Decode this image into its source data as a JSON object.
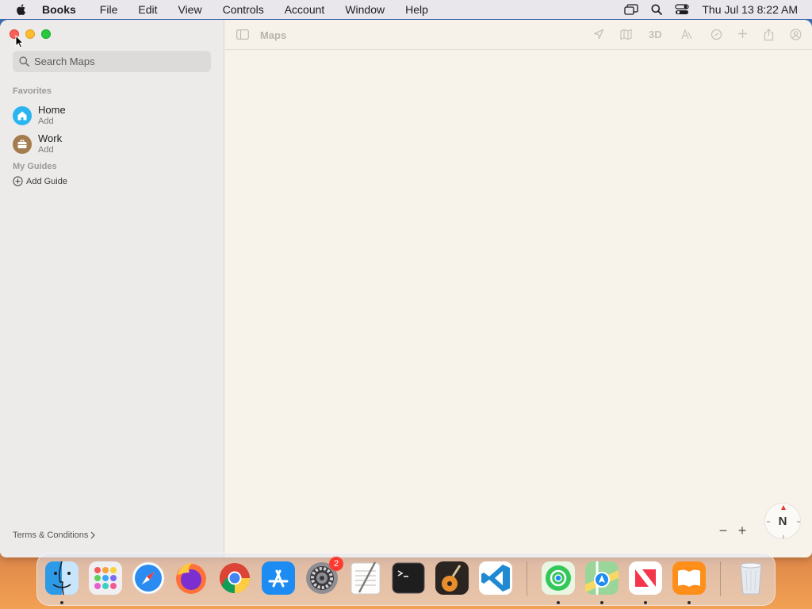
{
  "menubar": {
    "app_name": "Books",
    "items": [
      "File",
      "Edit",
      "View",
      "Controls",
      "Account",
      "Window",
      "Help"
    ],
    "clock": "Thu Jul 13  8:22 AM",
    "icons": [
      "display-icon",
      "spotlight-icon",
      "control-center-icon"
    ]
  },
  "window": {
    "title": "Maps",
    "search": {
      "placeholder": "Search Maps",
      "value": ""
    },
    "favorites_title": "Favorites",
    "favorites": [
      {
        "name": "Home",
        "sub": "Add",
        "icon": "house-icon",
        "color": "#2bb5f0"
      },
      {
        "name": "Work",
        "sub": "Add",
        "icon": "briefcase-icon",
        "color": "#a47c4f"
      }
    ],
    "guides_title": "My Guides",
    "add_guide_label": "Add Guide",
    "terms_label": "Terms & Conditions",
    "toolbar_icons": [
      "location-icon",
      "map-mode-icon",
      "3d-label",
      "look-around-icon",
      "tracking-icon",
      "add-icon",
      "share-icon",
      "account-icon"
    ],
    "toolbar_3d_label": "3D",
    "zoom_out_label": "−",
    "zoom_in_label": "+",
    "compass_label": "N"
  },
  "dock": {
    "apps": [
      {
        "name": "Finder",
        "running": true
      },
      {
        "name": "Launchpad",
        "running": false
      },
      {
        "name": "Safari",
        "running": false
      },
      {
        "name": "Firefox",
        "running": false
      },
      {
        "name": "Chrome",
        "running": false
      },
      {
        "name": "App Store",
        "running": false
      },
      {
        "name": "System Settings",
        "running": false,
        "badge": "2"
      },
      {
        "name": "TextEdit",
        "running": false
      },
      {
        "name": "Terminal",
        "running": false
      },
      {
        "name": "GarageBand",
        "running": false
      },
      {
        "name": "Visual Studio Code",
        "running": false
      },
      {
        "name": "Find My",
        "running": true
      },
      {
        "name": "Maps",
        "running": true
      },
      {
        "name": "News",
        "running": true
      },
      {
        "name": "Books",
        "running": true
      },
      {
        "name": "Trash",
        "running": false
      }
    ]
  },
  "colors": {
    "menubar_bg": "#e9e7ec",
    "sidebar_bg": "#ecebea",
    "map_bg": "#f8f3ea"
  }
}
